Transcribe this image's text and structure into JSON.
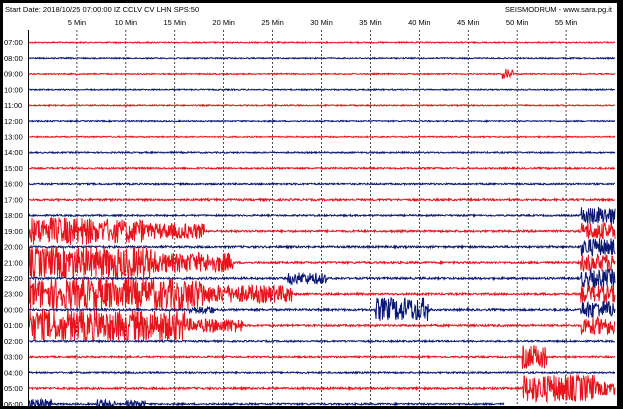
{
  "header": {
    "left": "Start Date: 2018/10/25 07:00:00 IZ CCLV CV LHN SPS:50",
    "right": "SEISMODRUM - www.sara.pg.it"
  },
  "colors": {
    "red": "#e8141c",
    "blue": "#0a1874",
    "grid": "#000000",
    "background": "#ffffff"
  },
  "chart_data": {
    "type": "line",
    "title": "Start Date: 2018/10/25 07:00:00 IZ CCLV CV LHN SPS:50",
    "x_tick_labels": [
      "5 Min",
      "10 Min",
      "15 Min",
      "20 Min",
      "25 Min",
      "30 Min",
      "35 Min",
      "40 Min",
      "45 Min",
      "50 Min",
      "55 Min"
    ],
    "x_ticks_min": [
      5,
      10,
      15,
      20,
      25,
      30,
      35,
      40,
      45,
      50,
      55
    ],
    "xlim_min": [
      0,
      60
    ],
    "grid": true,
    "rows": [
      {
        "label": "07:00",
        "color": "red",
        "base_amp": 0.6,
        "events": []
      },
      {
        "label": "08:00",
        "color": "blue",
        "base_amp": 0.6,
        "events": []
      },
      {
        "label": "09:00",
        "color": "red",
        "base_amp": 0.6,
        "events": [
          {
            "start": 48.5,
            "end": 49.6,
            "amp": 5
          }
        ]
      },
      {
        "label": "10:00",
        "color": "blue",
        "base_amp": 0.6,
        "events": []
      },
      {
        "label": "11:00",
        "color": "red",
        "base_amp": 0.6,
        "events": []
      },
      {
        "label": "12:00",
        "color": "blue",
        "base_amp": 0.6,
        "events": []
      },
      {
        "label": "13:00",
        "color": "red",
        "base_amp": 0.6,
        "events": []
      },
      {
        "label": "14:00",
        "color": "blue",
        "base_amp": 0.7,
        "events": []
      },
      {
        "label": "15:00",
        "color": "red",
        "base_amp": 0.8,
        "events": []
      },
      {
        "label": "16:00",
        "color": "blue",
        "base_amp": 0.8,
        "events": []
      },
      {
        "label": "17:00",
        "color": "red",
        "base_amp": 1.0,
        "events": []
      },
      {
        "label": "18:00",
        "color": "blue",
        "base_amp": 0.8,
        "events": [
          {
            "start": 56.5,
            "end": 60,
            "amp": 9
          }
        ]
      },
      {
        "label": "19:00",
        "color": "red",
        "base_amp": 1.0,
        "events": [
          {
            "start": 0,
            "end": 6.5,
            "amp": 14
          },
          {
            "start": 6.5,
            "end": 12,
            "amp": 12
          },
          {
            "start": 12,
            "end": 18,
            "amp": 8
          },
          {
            "start": 56.5,
            "end": 60,
            "amp": 9
          }
        ]
      },
      {
        "label": "20:00",
        "color": "blue",
        "base_amp": 1.0,
        "events": [
          {
            "start": 56.5,
            "end": 60,
            "amp": 9
          }
        ]
      },
      {
        "label": "21:00",
        "color": "red",
        "base_amp": 1.0,
        "events": [
          {
            "start": 0,
            "end": 13,
            "amp": 16
          },
          {
            "start": 13,
            "end": 21,
            "amp": 10
          },
          {
            "start": 56.5,
            "end": 60,
            "amp": 9
          }
        ]
      },
      {
        "label": "22:00",
        "color": "blue",
        "base_amp": 1.0,
        "events": [
          {
            "start": 26.5,
            "end": 30.5,
            "amp": 6
          },
          {
            "start": 56.5,
            "end": 60,
            "amp": 9
          }
        ]
      },
      {
        "label": "23:00",
        "color": "red",
        "base_amp": 1.0,
        "events": [
          {
            "start": 0,
            "end": 18,
            "amp": 16
          },
          {
            "start": 18,
            "end": 27,
            "amp": 9
          },
          {
            "start": 56.5,
            "end": 60,
            "amp": 9
          }
        ]
      },
      {
        "label": "00:00",
        "color": "blue",
        "base_amp": 1.0,
        "events": [
          {
            "start": 16.5,
            "end": 19,
            "amp": 4
          },
          {
            "start": 35.5,
            "end": 41,
            "amp": 12
          },
          {
            "start": 56.5,
            "end": 60,
            "amp": 9
          }
        ]
      },
      {
        "label": "01:00",
        "color": "red",
        "base_amp": 1.0,
        "events": [
          {
            "start": 0,
            "end": 16,
            "amp": 16
          },
          {
            "start": 16,
            "end": 22,
            "amp": 7
          },
          {
            "start": 56.5,
            "end": 60,
            "amp": 9
          }
        ]
      },
      {
        "label": "02:00",
        "color": "blue",
        "base_amp": 0.8,
        "events": []
      },
      {
        "label": "03:00",
        "color": "red",
        "base_amp": 0.8,
        "events": [
          {
            "start": 50.5,
            "end": 53,
            "amp": 12
          }
        ]
      },
      {
        "label": "04:00",
        "color": "blue",
        "base_amp": 0.8,
        "events": []
      },
      {
        "label": "05:00",
        "color": "red",
        "base_amp": 1.0,
        "events": [
          {
            "start": 50.5,
            "end": 58,
            "amp": 14
          },
          {
            "start": 58,
            "end": 60,
            "amp": 7
          }
        ]
      },
      {
        "label": "06:00",
        "color": "blue",
        "base_amp": 0.9,
        "events": [
          {
            "start": 0,
            "end": 2.5,
            "amp": 5
          },
          {
            "start": 7,
            "end": 9,
            "amp": 5
          },
          {
            "start": 10,
            "end": 12,
            "amp": 4
          }
        ],
        "end_min": 48.7
      }
    ]
  }
}
